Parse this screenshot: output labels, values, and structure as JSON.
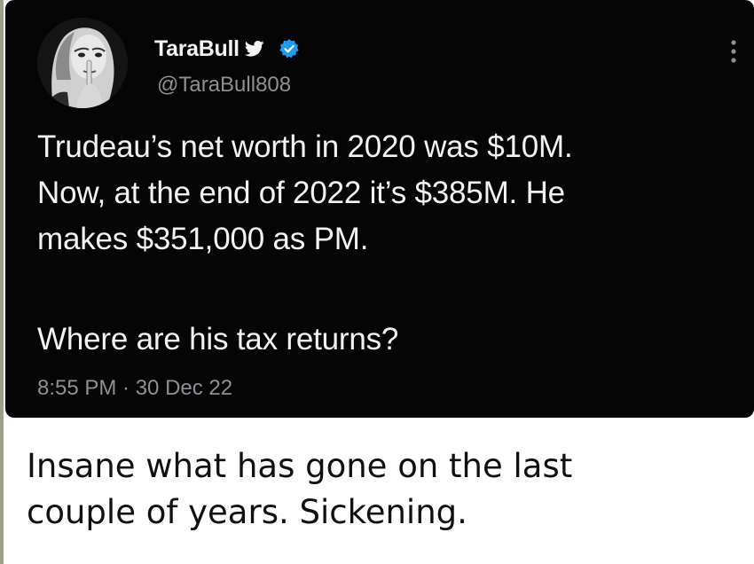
{
  "tweet": {
    "display_name": "TaraBull",
    "handle": "@TaraBull808",
    "body_lines": [
      "Trudeau’s net worth in 2020 was $10M.",
      "Now, at the end of 2022 it’s $385M. He",
      "makes $351,000 as PM."
    ],
    "question": "Where are his tax returns?",
    "timestamp": "8:55 PM · 30 Dec 22",
    "icons": {
      "bird": "twitter-bird-icon",
      "verified": "verified-badge-icon",
      "more": "more-options-icon"
    },
    "colors": {
      "background": "#050505",
      "text": "#f2f2f2",
      "muted": "#8c8f93",
      "verified": "#1d9bf0"
    }
  },
  "caption": {
    "lines": [
      "Insane what has gone on the last",
      "couple of years. Sickening."
    ]
  }
}
